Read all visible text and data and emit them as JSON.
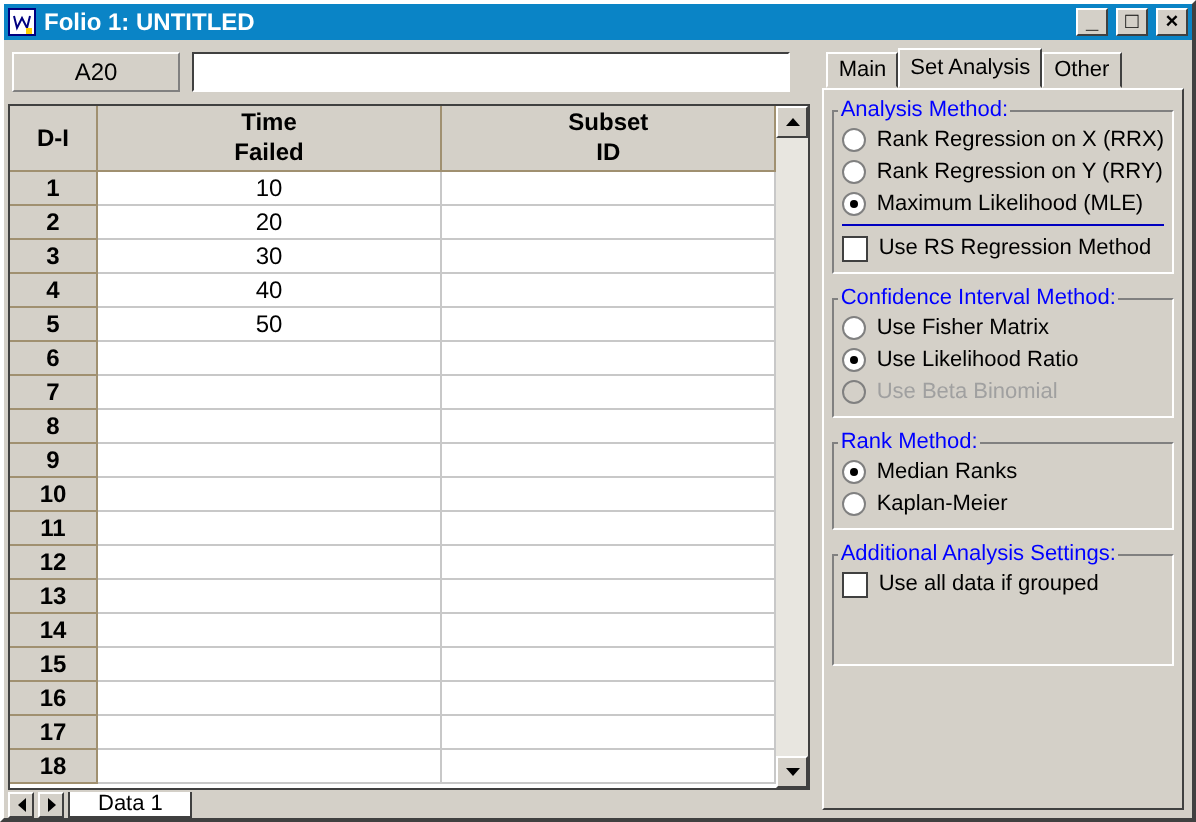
{
  "window": {
    "title": "Folio 1: UNTITLED",
    "controls": [
      "_",
      "□",
      "×"
    ]
  },
  "cell_ref": "A20",
  "table": {
    "columns": [
      "D-I",
      "Time\nFailed",
      "Subset\nID"
    ],
    "rows": [
      {
        "n": "1",
        "time": "10",
        "subset": ""
      },
      {
        "n": "2",
        "time": "20",
        "subset": ""
      },
      {
        "n": "3",
        "time": "30",
        "subset": ""
      },
      {
        "n": "4",
        "time": "40",
        "subset": ""
      },
      {
        "n": "5",
        "time": "50",
        "subset": ""
      },
      {
        "n": "6",
        "time": "",
        "subset": ""
      },
      {
        "n": "7",
        "time": "",
        "subset": ""
      },
      {
        "n": "8",
        "time": "",
        "subset": ""
      },
      {
        "n": "9",
        "time": "",
        "subset": ""
      },
      {
        "n": "10",
        "time": "",
        "subset": ""
      },
      {
        "n": "11",
        "time": "",
        "subset": ""
      },
      {
        "n": "12",
        "time": "",
        "subset": ""
      },
      {
        "n": "13",
        "time": "",
        "subset": ""
      },
      {
        "n": "14",
        "time": "",
        "subset": ""
      },
      {
        "n": "15",
        "time": "",
        "subset": ""
      },
      {
        "n": "16",
        "time": "",
        "subset": ""
      },
      {
        "n": "17",
        "time": "",
        "subset": ""
      },
      {
        "n": "18",
        "time": "",
        "subset": ""
      }
    ]
  },
  "sheet_tabs": [
    {
      "label": "Data 1",
      "selected": true
    }
  ],
  "tabs": [
    {
      "label": "Main",
      "selected": false
    },
    {
      "label": "Set Analysis",
      "selected": true
    },
    {
      "label": "Other",
      "selected": false
    }
  ],
  "groups": [
    {
      "title": "Analysis Method:",
      "items": [
        {
          "kind": "radio",
          "label": "Rank Regression on X (RRX)",
          "selected": false,
          "disabled": false
        },
        {
          "kind": "radio",
          "label": "Rank Regression on Y (RRY)",
          "selected": false,
          "disabled": false
        },
        {
          "kind": "radio",
          "label": "Maximum Likelihood (MLE)",
          "selected": true,
          "disabled": false
        },
        {
          "kind": "rule"
        },
        {
          "kind": "checkbox",
          "label": "Use RS Regression Method",
          "checked": false,
          "disabled": false
        }
      ]
    },
    {
      "title": "Confidence Interval Method:",
      "items": [
        {
          "kind": "radio",
          "label": "Use Fisher Matrix",
          "selected": false,
          "disabled": false
        },
        {
          "kind": "radio",
          "label": "Use Likelihood Ratio",
          "selected": true,
          "disabled": false
        },
        {
          "kind": "radio",
          "label": "Use Beta Binomial",
          "selected": false,
          "disabled": true
        }
      ]
    },
    {
      "title": "Rank Method:",
      "items": [
        {
          "kind": "radio",
          "label": "Median Ranks",
          "selected": true,
          "disabled": false
        },
        {
          "kind": "radio",
          "label": "Kaplan-Meier",
          "selected": false,
          "disabled": false
        }
      ]
    },
    {
      "title": "Additional Analysis Settings:",
      "items": [
        {
          "kind": "checkbox",
          "label": "Use all data if grouped",
          "checked": false,
          "disabled": false
        }
      ]
    }
  ]
}
